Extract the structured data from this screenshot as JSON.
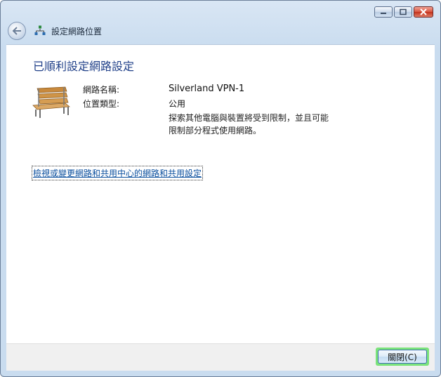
{
  "window": {
    "breadcrumb_title": "設定網路位置",
    "caption_buttons": [
      "minimize",
      "maximize",
      "close"
    ]
  },
  "content": {
    "heading": "已順利設定網路設定",
    "network_name_label": "網路名稱:",
    "network_name_value": "Silverland VPN-1",
    "location_type_label": "位置類型:",
    "location_type_value": "公用",
    "description_line1": "探索其他電腦與裝置將受到限制，並且可能",
    "description_line2": "限制部分程式使用網路。",
    "link_text": "檢視或變更網路和共用中心的網路和共用設定"
  },
  "footer": {
    "close_button_label": "關閉(C)"
  },
  "colors": {
    "heading": "#1f3f88",
    "link": "#0b4f9e",
    "focus_highlight": "#7be37b"
  },
  "icons": {
    "back": "back-arrow-icon",
    "breadcrumb": "network-icon",
    "location": "park-bench-icon"
  }
}
